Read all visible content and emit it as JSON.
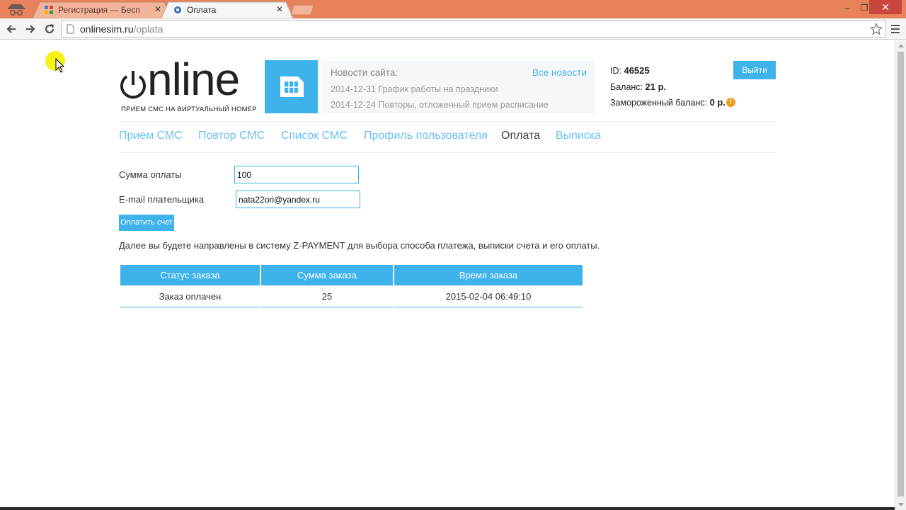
{
  "browser": {
    "tabs": [
      {
        "title": "Регистрация — Бесплатн"
      },
      {
        "title": "Оплата"
      }
    ],
    "url_host": "onlinesim.ru",
    "url_path": "/oplata",
    "titlebar_color": "#e8825a"
  },
  "header": {
    "logo_word": "nline",
    "tagline": "ПРИЕМ СМС НА ВИРТУАЛЬНЫЙ НОМЕР",
    "news": {
      "title": "Новости сайта:",
      "all_link": "Все новости",
      "items": [
        "2014-12-31 График работы на праздники",
        "2014-12-24 Повторы, отложенный прием расписание"
      ]
    },
    "account": {
      "id_label": "ID:",
      "id_value": "46525",
      "balance_label": "Баланс:",
      "balance_value": "21 р.",
      "frozen_label": "Замороженный баланс:",
      "frozen_value": "0 р.",
      "warn_glyph": "!"
    },
    "logout_label": "Выйти"
  },
  "nav": {
    "items": [
      {
        "label": "Прием СМС"
      },
      {
        "label": "Повтор СМС"
      },
      {
        "label": "Список СМС"
      },
      {
        "label": "Профиль пользователя"
      },
      {
        "label": "Оплата",
        "active": true
      },
      {
        "label": "Выписка"
      }
    ]
  },
  "form": {
    "amount_label": "Сумма оплаты",
    "amount_value": "100",
    "email_label": "E-mail плательщика",
    "email_value": "nata22ori@yandex.ru",
    "submit_label": "Оплатить счет",
    "info": "Далее вы будете направлены в систему Z-PAYMENT для выбора способа платежа, выписки счета и его оплаты."
  },
  "orders": {
    "columns": [
      "Статус заказа",
      "Сумма заказа",
      "Время заказа"
    ],
    "rows": [
      [
        "Заказ оплачен",
        "25",
        "2015-02-04 06:49:10"
      ]
    ]
  },
  "colors": {
    "accent": "#3db2eb",
    "nav_link": "#6cc0ef",
    "warning": "#f39a1e"
  }
}
